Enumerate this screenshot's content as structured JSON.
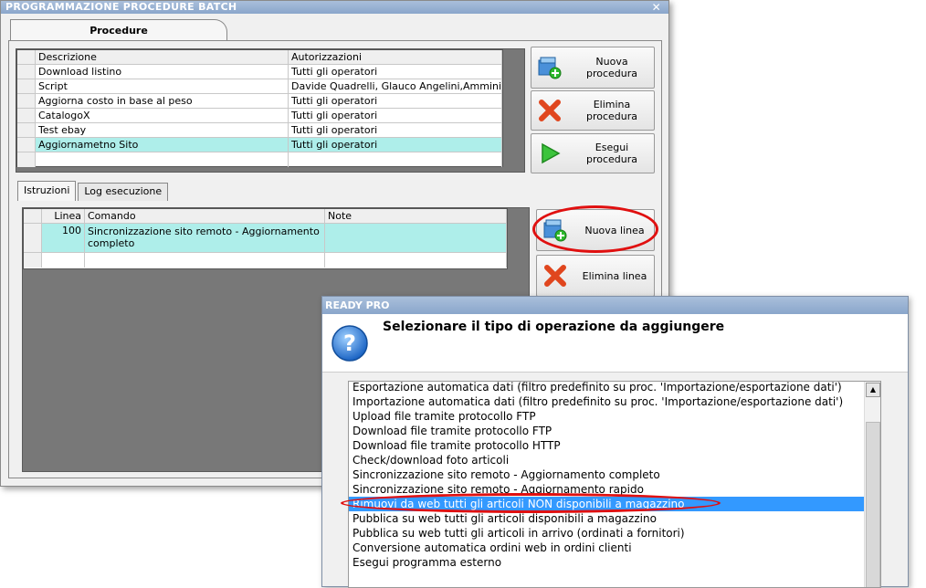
{
  "window": {
    "title": "PROGRAMMAZIONE PROCEDURE BATCH",
    "close_label": "✕",
    "tab_label": "Procedure"
  },
  "procedures": {
    "columns": [
      "Descrizione",
      "Autorizzazioni"
    ],
    "rows": [
      {
        "descrizione": "Download listino",
        "autorizzazioni": "Tutti gli operatori"
      },
      {
        "descrizione": "Script",
        "autorizzazioni": "Davide Quadrelli, Glauco Angelini,Amministra…"
      },
      {
        "descrizione": "Aggiorna costo in base al peso",
        "autorizzazioni": "Tutti gli operatori"
      },
      {
        "descrizione": "CatalogoX",
        "autorizzazioni": "Tutti gli operatori"
      },
      {
        "descrizione": "Test ebay",
        "autorizzazioni": "Tutti gli operatori"
      },
      {
        "descrizione": "Aggiornametno Sito",
        "autorizzazioni": "Tutti gli operatori"
      }
    ]
  },
  "buttons": {
    "nuova_procedura": "Nuova procedura",
    "elimina_procedura": "Elimina procedura",
    "esegui_procedura": "Esegui procedura",
    "nuova_linea": "Nuova linea",
    "elimina_linea": "Elimina linea"
  },
  "subtabs": {
    "istruzioni": "Istruzioni",
    "log": "Log esecuzione"
  },
  "instructions": {
    "columns": [
      "Linea",
      "Comando",
      "Note"
    ],
    "rows": [
      {
        "linea": "100",
        "comando_1": "Sincronizzazione sito remoto - Aggiornamento",
        "comando_2": "completo",
        "note": ""
      }
    ]
  },
  "dialog": {
    "title": "READY PRO",
    "heading": "Selezionare il tipo di operazione da aggiungere",
    "items": [
      "Esportazione automatica dati (filtro predefinito su proc. 'Importazione/esportazione dati')",
      "Importazione automatica dati (filtro predefinito su proc. 'Importazione/esportazione dati')",
      "Upload file tramite protocollo FTP",
      "Download file tramite protocollo FTP",
      "Download file tramite protocollo HTTP",
      "Check/download foto articoli",
      "Sincronizzazione sito remoto - Aggiornamento completo",
      "Sincronizzazione sito remoto - Aggiornamento rapido",
      "Rimuovi da web tutti gli articoli NON disponibili a magazzino",
      "Pubblica su web tutti gli articoli disponibili a magazzino",
      "Pubblica su web tutti gli articoli in arrivo (ordinati a fornitori)",
      "Conversione automatica ordini web in ordini clienti",
      "Esegui programma esterno"
    ]
  },
  "colors": {
    "selection_row": "#aeeeea",
    "list_highlight": "#3399ff",
    "annotation_red": "#e01010"
  }
}
